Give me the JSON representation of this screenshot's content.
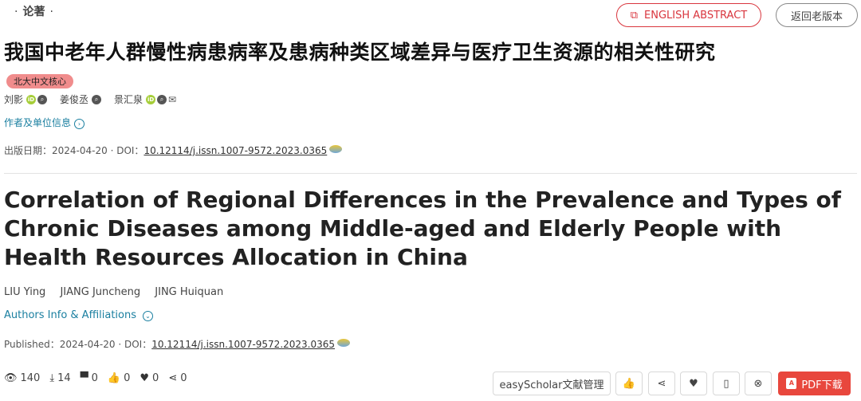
{
  "header": {
    "section_label": "论著",
    "english_abstract_button": "ENGLISH ABSTRACT",
    "old_version_button": "返回老版本"
  },
  "cn": {
    "title": "我国中老年人群慢性病患病率及患病种类区域差异与医疗卫生资源的相关性研究",
    "badge": "北大中文核心",
    "authors": [
      "刘影",
      "姜俊丞",
      "景汇泉"
    ],
    "affiliations_link": "作者及单位信息",
    "pub_label": "出版日期：",
    "pub_date": "2024-04-20",
    "doi_label": " · DOI：",
    "doi": "10.12114/j.issn.1007-9572.2023.0365"
  },
  "en": {
    "title": "Correlation of Regional Differences in the Prevalence and Types of Chronic Diseases among Middle-aged and Elderly People with Health Resources Allocation in China",
    "authors": [
      "LIU Ying",
      "JIANG Juncheng",
      "JING Huiquan"
    ],
    "affiliations_link": "Authors Info & Affiliations",
    "pub_label": "Published：",
    "pub_date": "2024-04-20",
    "doi_label": " · DOI：",
    "doi": "10.12114/j.issn.1007-9572.2023.0365"
  },
  "stats": {
    "views": "140",
    "downloads": "14",
    "comments": "0",
    "likes": "0",
    "favorites": "0",
    "shares": "0"
  },
  "toolbar": {
    "easyscholar_label": "easyScholar文献管理",
    "pdf_label": "PDF下载"
  },
  "colors": {
    "accent_red": "#d9363e",
    "link_teal": "#1a7fa0",
    "pdf_red": "#e8473d",
    "badge_pink": "#f08c8c"
  }
}
